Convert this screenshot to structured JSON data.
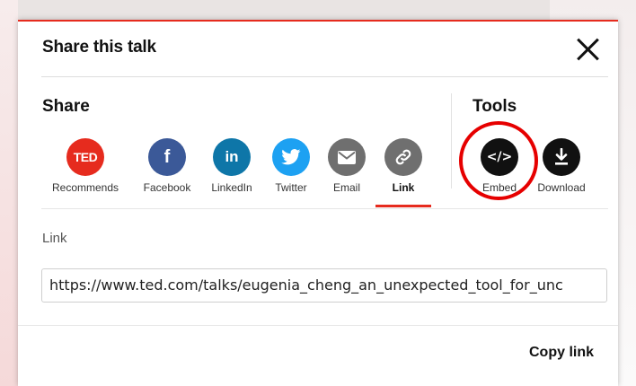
{
  "dialog": {
    "title": "Share this talk",
    "close_label": "Close"
  },
  "share": {
    "heading": "Share",
    "items": [
      {
        "label": "Recommends",
        "icon": "ted-logo-icon",
        "badge_text": "TED",
        "color": "#e62b1e"
      },
      {
        "label": "Facebook",
        "icon": "facebook-icon",
        "glyph": "f",
        "color": "#3b5998"
      },
      {
        "label": "LinkedIn",
        "icon": "linkedin-icon",
        "glyph": "in",
        "color": "#0e76a8"
      },
      {
        "label": "Twitter",
        "icon": "twitter-icon",
        "color": "#1da1f2"
      },
      {
        "label": "Email",
        "icon": "email-icon",
        "color": "#6f6f6f"
      },
      {
        "label": "Link",
        "icon": "link-icon",
        "color": "#6f6f6f",
        "active": true
      }
    ]
  },
  "tools": {
    "heading": "Tools",
    "items": [
      {
        "label": "Embed",
        "icon": "embed-code-icon",
        "glyph": "</>",
        "color": "#111111",
        "highlighted": true
      },
      {
        "label": "Download",
        "icon": "download-icon",
        "color": "#111111"
      }
    ]
  },
  "link": {
    "label": "Link",
    "url": "https://www.ted.com/talks/eugenia_cheng_an_unexpected_tool_for_unc"
  },
  "footer": {
    "copy_label": "Copy link"
  },
  "colors": {
    "accent": "#e62b1e",
    "highlight_ring": "#e60000"
  }
}
